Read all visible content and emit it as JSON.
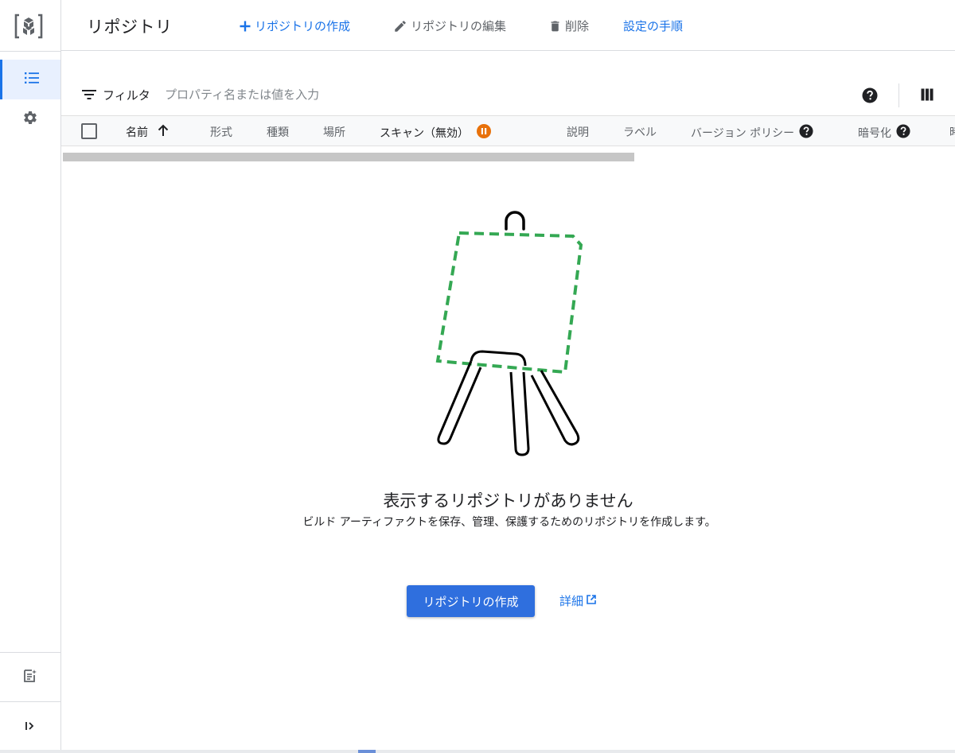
{
  "header": {
    "title": "リポジトリ",
    "actions": {
      "create": "リポジトリの作成",
      "edit": "リポジトリの編集",
      "delete": "削除",
      "setup": "設定の手順"
    }
  },
  "filter": {
    "label": "フィルタ",
    "placeholder": "プロパティ名または値を入力"
  },
  "table": {
    "columns": {
      "name": "名前",
      "format": "形式",
      "type": "種類",
      "location": "場所",
      "scan": "スキャン（無効）",
      "description": "説明",
      "labels": "ラベル",
      "version_policy": "バージョン ポリシー",
      "encryption": "暗号化",
      "more": "時"
    }
  },
  "empty_state": {
    "title": "表示するリポジトリがありません",
    "description": "ビルド アーティファクトを保存、管理、保護するためのリポジトリを作成します。",
    "create_button": "リポジトリの作成",
    "learn_more": "詳細"
  },
  "colors": {
    "accent": "#1a73e8",
    "primary_button": "#2f6fde",
    "scan_status": "#e8710a",
    "illustration_dash": "#34a853"
  }
}
